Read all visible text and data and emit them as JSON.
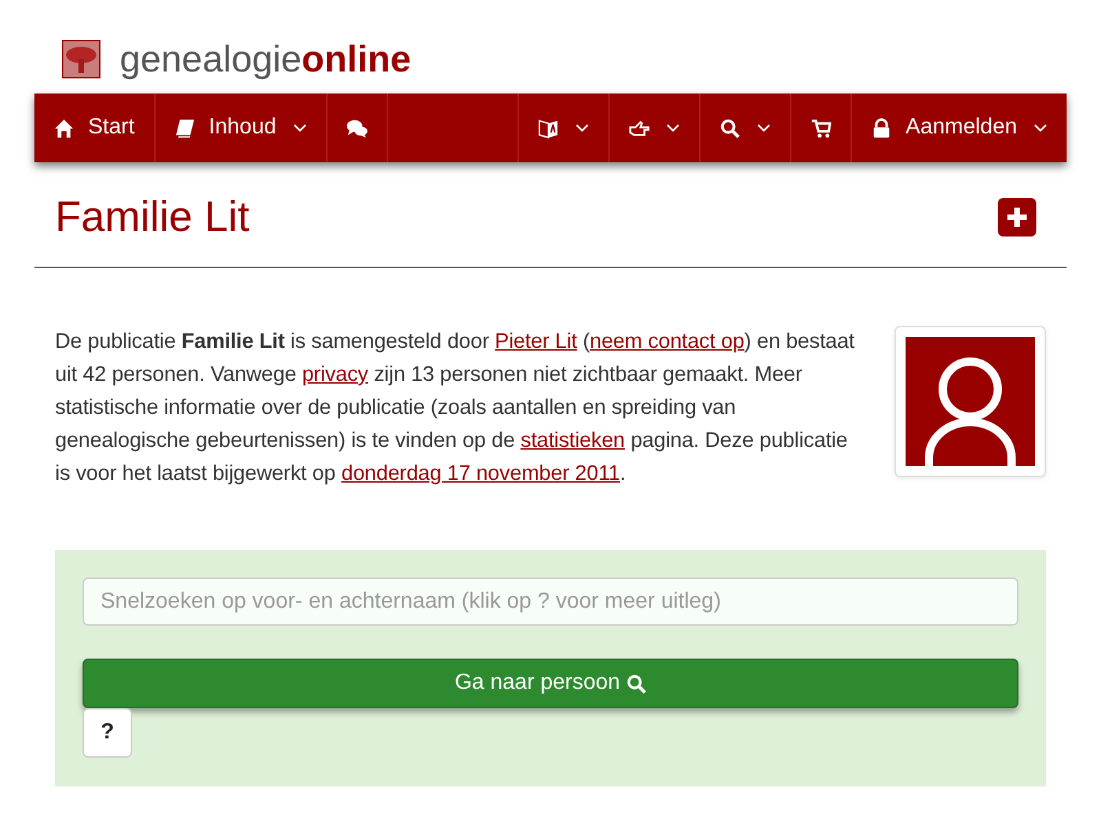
{
  "logo": {
    "prefix": "genealogie",
    "suffix": "online"
  },
  "nav": {
    "left": [
      {
        "kind": "home",
        "label": "Start",
        "dropdown": false
      },
      {
        "kind": "book",
        "label": "Inhoud",
        "dropdown": true
      },
      {
        "kind": "chat",
        "dropdown": false
      }
    ],
    "right": [
      {
        "kind": "translate",
        "dropdown": true
      },
      {
        "kind": "hand",
        "dropdown": true
      },
      {
        "kind": "search",
        "dropdown": true
      },
      {
        "kind": "cart",
        "dropdown": false
      },
      {
        "kind": "lock",
        "label": "Aanmelden",
        "dropdown": true
      }
    ]
  },
  "page_title": "Familie Lit",
  "intro": [
    {
      "kind": "text",
      "text": "De publicatie "
    },
    {
      "kind": "bold",
      "text": "Familie Lit"
    },
    {
      "kind": "text",
      "text": " is samengesteld door "
    },
    {
      "kind": "link",
      "text": "Pieter Lit"
    },
    {
      "kind": "text",
      "text": " ("
    },
    {
      "kind": "link",
      "text": "neem contact op"
    },
    {
      "kind": "text",
      "text": ") en bestaat uit 42 personen. Vanwege "
    },
    {
      "kind": "link",
      "text": "privacy"
    },
    {
      "kind": "text",
      "text": " zijn 13 personen niet zichtbaar gemaakt. Meer statistische informatie over de publicatie (zoals aantallen en spreiding van genealogische gebeurtenissen) is te vinden op de "
    },
    {
      "kind": "link",
      "text": "statistieken"
    },
    {
      "kind": "text",
      "text": " pagina. Deze publicatie is voor het laatst bijgewerkt op "
    },
    {
      "kind": "link",
      "text": "donderdag 17 november 2011"
    },
    {
      "kind": "text",
      "text": "."
    }
  ],
  "search": {
    "placeholder": "Snelzoeken op voor- en achternaam (klik op ? voor meer uitleg)",
    "button": "Ga naar persoon",
    "help": "?"
  }
}
